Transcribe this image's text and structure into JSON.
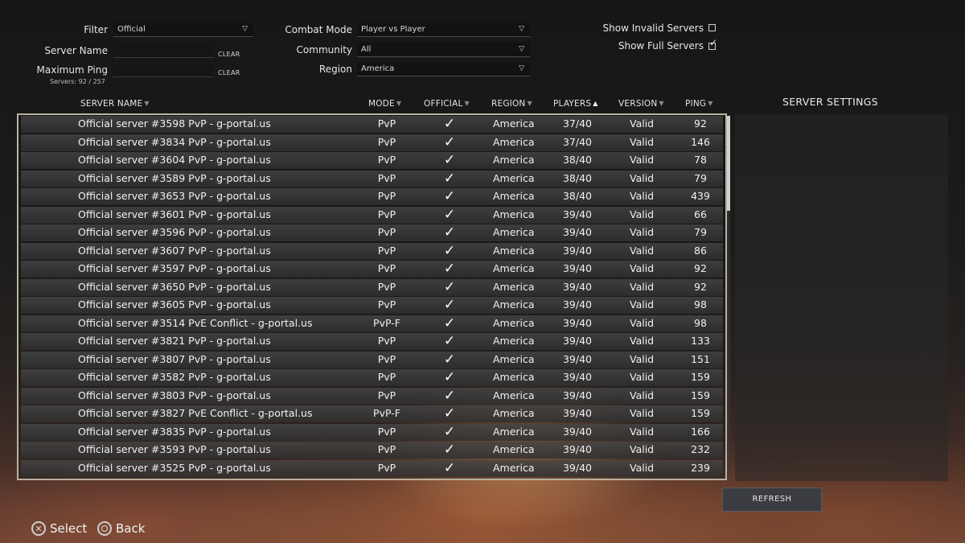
{
  "filters": {
    "filter_label": "Filter",
    "filter_value": "Official",
    "server_name_label": "Server Name",
    "server_name_value": "",
    "max_ping_label": "Maximum Ping",
    "max_ping_value": "",
    "clear_label": "CLEAR",
    "servers_count": "Servers: 92 / 257",
    "combat_mode_label": "Combat Mode",
    "combat_mode_value": "Player vs Player",
    "community_label": "Community",
    "community_value": "All",
    "region_label": "Region",
    "region_value": "America",
    "show_invalid_label": "Show Invalid Servers",
    "show_invalid_checked": false,
    "show_full_label": "Show Full Servers",
    "show_full_checked": true
  },
  "columns": {
    "server_name": "SERVER NAME",
    "mode": "MODE",
    "official": "OFFICIAL",
    "region": "REGION",
    "players": "PLAYERS",
    "version": "VERSION",
    "ping": "PING"
  },
  "servers": [
    {
      "name": "Official server #3598 PvP - g-portal.us",
      "mode": "PvP",
      "official": "✓",
      "region": "America",
      "players": "37/40",
      "version": "Valid",
      "ping": "92"
    },
    {
      "name": "Official server #3834 PvP - g-portal.us",
      "mode": "PvP",
      "official": "✓",
      "region": "America",
      "players": "37/40",
      "version": "Valid",
      "ping": "146"
    },
    {
      "name": "Official server #3604 PvP - g-portal.us",
      "mode": "PvP",
      "official": "✓",
      "region": "America",
      "players": "38/40",
      "version": "Valid",
      "ping": "78"
    },
    {
      "name": "Official server #3589 PvP - g-portal.us",
      "mode": "PvP",
      "official": "✓",
      "region": "America",
      "players": "38/40",
      "version": "Valid",
      "ping": "79"
    },
    {
      "name": "Official server #3653 PvP - g-portal.us",
      "mode": "PvP",
      "official": "✓",
      "region": "America",
      "players": "38/40",
      "version": "Valid",
      "ping": "439"
    },
    {
      "name": "Official server #3601 PvP - g-portal.us",
      "mode": "PvP",
      "official": "✓",
      "region": "America",
      "players": "39/40",
      "version": "Valid",
      "ping": "66"
    },
    {
      "name": "Official server #3596 PvP - g-portal.us",
      "mode": "PvP",
      "official": "✓",
      "region": "America",
      "players": "39/40",
      "version": "Valid",
      "ping": "79"
    },
    {
      "name": "Official server #3607 PvP - g-portal.us",
      "mode": "PvP",
      "official": "✓",
      "region": "America",
      "players": "39/40",
      "version": "Valid",
      "ping": "86"
    },
    {
      "name": "Official server #3597 PvP - g-portal.us",
      "mode": "PvP",
      "official": "✓",
      "region": "America",
      "players": "39/40",
      "version": "Valid",
      "ping": "92"
    },
    {
      "name": "Official server #3650 PvP - g-portal.us",
      "mode": "PvP",
      "official": "✓",
      "region": "America",
      "players": "39/40",
      "version": "Valid",
      "ping": "92"
    },
    {
      "name": "Official server #3605 PvP - g-portal.us",
      "mode": "PvP",
      "official": "✓",
      "region": "America",
      "players": "39/40",
      "version": "Valid",
      "ping": "98"
    },
    {
      "name": "Official server #3514 PvE Conflict - g-portal.us",
      "mode": "PvP-F",
      "official": "✓",
      "region": "America",
      "players": "39/40",
      "version": "Valid",
      "ping": "98"
    },
    {
      "name": "Official server #3821 PvP - g-portal.us",
      "mode": "PvP",
      "official": "✓",
      "region": "America",
      "players": "39/40",
      "version": "Valid",
      "ping": "133"
    },
    {
      "name": "Official server #3807 PvP - g-portal.us",
      "mode": "PvP",
      "official": "✓",
      "region": "America",
      "players": "39/40",
      "version": "Valid",
      "ping": "151"
    },
    {
      "name": "Official server #3582 PvP - g-portal.us",
      "mode": "PvP",
      "official": "✓",
      "region": "America",
      "players": "39/40",
      "version": "Valid",
      "ping": "159"
    },
    {
      "name": "Official server #3803 PvP - g-portal.us",
      "mode": "PvP",
      "official": "✓",
      "region": "America",
      "players": "39/40",
      "version": "Valid",
      "ping": "159"
    },
    {
      "name": "Official server #3827 PvE Conflict - g-portal.us",
      "mode": "PvP-F",
      "official": "✓",
      "region": "America",
      "players": "39/40",
      "version": "Valid",
      "ping": "159"
    },
    {
      "name": "Official server #3835 PvP - g-portal.us",
      "mode": "PvP",
      "official": "✓",
      "region": "America",
      "players": "39/40",
      "version": "Valid",
      "ping": "166"
    },
    {
      "name": "Official server #3593 PvP - g-portal.us",
      "mode": "PvP",
      "official": "✓",
      "region": "America",
      "players": "39/40",
      "version": "Valid",
      "ping": "232"
    },
    {
      "name": "Official server #3525 PvP - g-portal.us",
      "mode": "PvP",
      "official": "✓",
      "region": "America",
      "players": "39/40",
      "version": "Valid",
      "ping": "239"
    }
  ],
  "panel": {
    "settings_title": "SERVER SETTINGS",
    "refresh_label": "REFRESH"
  },
  "hints": {
    "select_label": "Select",
    "select_icon": "cross-button-icon",
    "back_label": "Back",
    "back_icon": "circle-button-icon"
  }
}
